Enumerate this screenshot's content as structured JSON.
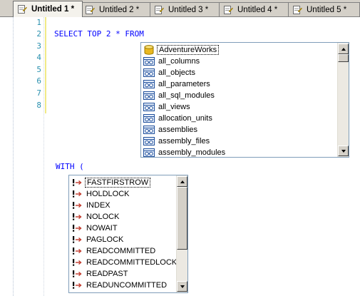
{
  "tabs": [
    {
      "label": "Untitled 1 *",
      "active": true
    },
    {
      "label": "Untitled 2 *",
      "active": false
    },
    {
      "label": "Untitled 3 *",
      "active": false
    },
    {
      "label": "Untitled 4 *",
      "active": false
    },
    {
      "label": "Untitled 5 *",
      "active": false
    }
  ],
  "editor": {
    "line_numbers": [
      "1",
      "2",
      "3",
      "4",
      "5",
      "6",
      "7",
      "8"
    ],
    "line2_code": "SELECT TOP 2 * FROM",
    "with_code": "WITH ("
  },
  "object_list": {
    "items": [
      {
        "label": "AdventureWorks",
        "icon": "database-icon"
      },
      {
        "label": "all_columns",
        "icon": "view-icon"
      },
      {
        "label": "all_objects",
        "icon": "view-icon"
      },
      {
        "label": "all_parameters",
        "icon": "view-icon"
      },
      {
        "label": "all_sql_modules",
        "icon": "view-icon"
      },
      {
        "label": "all_views",
        "icon": "view-icon"
      },
      {
        "label": "allocation_units",
        "icon": "view-icon"
      },
      {
        "label": "assemblies",
        "icon": "view-icon"
      },
      {
        "label": "assembly_files",
        "icon": "view-icon"
      },
      {
        "label": "assembly_modules",
        "icon": "view-icon"
      }
    ]
  },
  "hint_list": {
    "items": [
      {
        "label": "FASTFIRSTROW",
        "icon": "hint-icon"
      },
      {
        "label": "HOLDLOCK",
        "icon": "hint-icon"
      },
      {
        "label": "INDEX",
        "icon": "hint-icon"
      },
      {
        "label": "NOLOCK",
        "icon": "hint-icon"
      },
      {
        "label": "NOWAIT",
        "icon": "hint-icon"
      },
      {
        "label": "PAGLOCK",
        "icon": "hint-icon"
      },
      {
        "label": "READCOMMITTED",
        "icon": "hint-icon"
      },
      {
        "label": "READCOMMITTEDLOCK",
        "icon": "hint-icon"
      },
      {
        "label": "READPAST",
        "icon": "hint-icon"
      },
      {
        "label": "READUNCOMMITTED",
        "icon": "hint-icon"
      }
    ]
  },
  "colors": {
    "keyword": "#0000ff",
    "line_number": "#2b91af",
    "tab_bar": "#d4d0c8",
    "list_border": "#7f9db9"
  }
}
